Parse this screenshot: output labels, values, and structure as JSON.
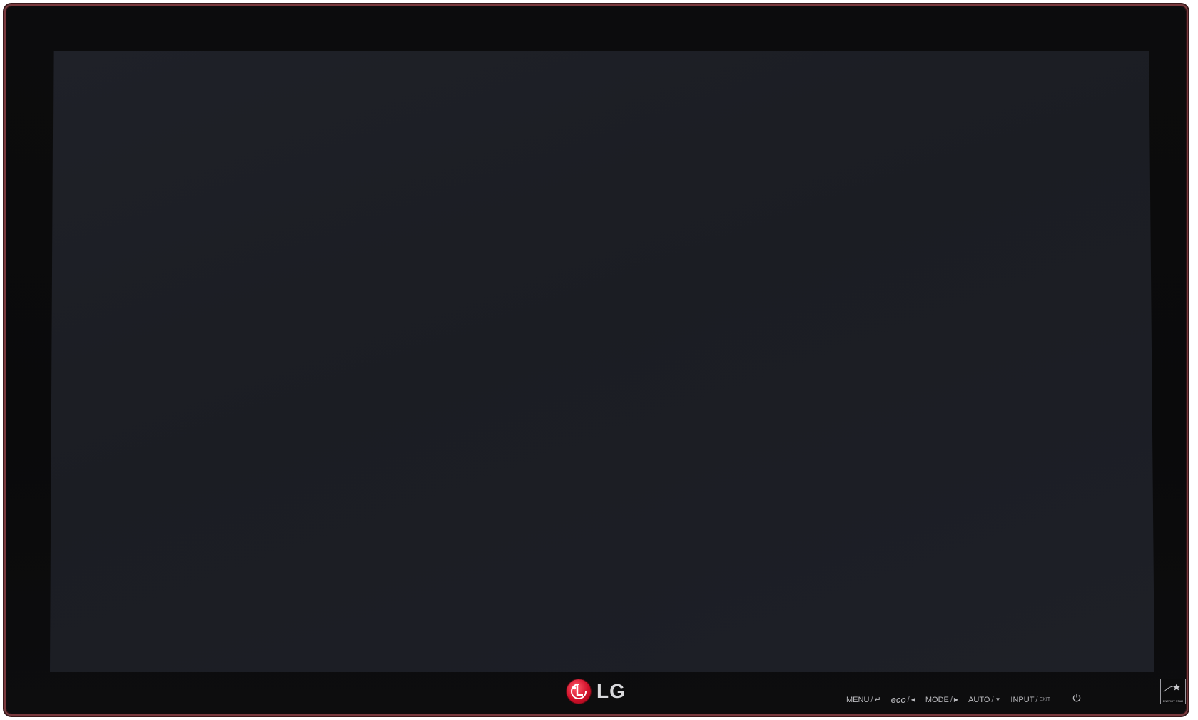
{
  "brand": {
    "logo_text": "LG",
    "logo_color": "#d2102a"
  },
  "controls": {
    "menu": {
      "label": "MENU",
      "symbol": "↵"
    },
    "eco": {
      "label": "eco",
      "symbol": "◀"
    },
    "mode": {
      "label": "MODE",
      "symbol": "▶"
    },
    "auto": {
      "label": "AUTO",
      "symbol": "▼"
    },
    "input": {
      "label": "INPUT",
      "symbol": "EXIT"
    },
    "separator": "/"
  },
  "power_icon": "power-icon",
  "energy_star_text": "ENERGY STAR",
  "colors": {
    "bezel": "#0b0b0c",
    "screen": "#1d1f26",
    "trim": "#7a3a3e"
  }
}
